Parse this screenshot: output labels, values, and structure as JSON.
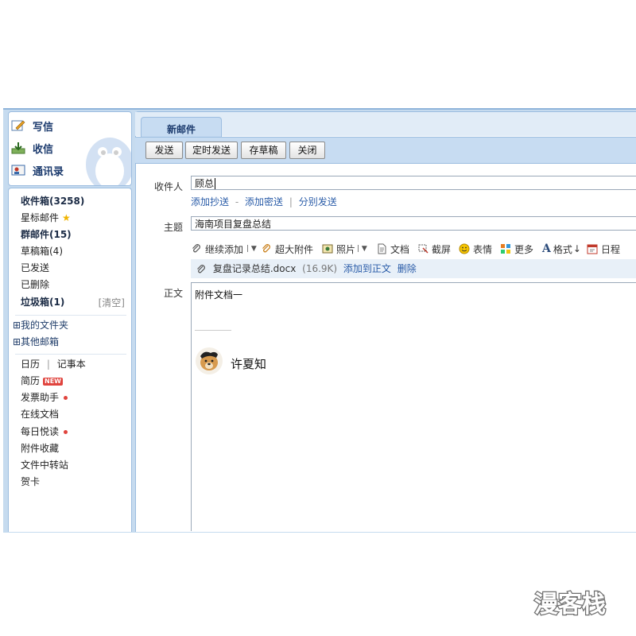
{
  "sidebar": {
    "actions": [
      {
        "label": "写信",
        "icon": "pencil-icon"
      },
      {
        "label": "收信",
        "icon": "inbox-download-icon"
      },
      {
        "label": "通讯录",
        "icon": "contacts-card-icon"
      }
    ],
    "folders": {
      "inbox": "收件箱(3258)",
      "starred": "星标邮件",
      "group": "群邮件(15)",
      "drafts": "草稿箱(4)",
      "sent": "已发送",
      "deleted": "已删除",
      "trash": "垃圾箱(1)",
      "trash_clear": "[清空]"
    },
    "tree": {
      "my_folders": "⊞我的文件夹",
      "other_mailboxes": "⊞其他邮箱"
    },
    "apps": {
      "calendar": "日历",
      "divider": "|",
      "notes": "记事本",
      "resume": "简历",
      "resume_badge": "NEW",
      "invoice": "发票助手",
      "online_docs": "在线文档",
      "daily_read": "每日悦读",
      "attachments": "附件收藏",
      "file_transfer": "文件中转站",
      "cards": "贺卡"
    }
  },
  "tab": {
    "label": "新邮件"
  },
  "toolbar": {
    "send": "发送",
    "schedule": "定时发送",
    "save_draft": "存草稿",
    "close": "关闭"
  },
  "compose": {
    "to_label": "收件人",
    "to_value": "顾总",
    "cc": "添加抄送",
    "dash": "-",
    "bcc": "添加密送",
    "pipe": "|",
    "separate": "分别发送",
    "subject_label": "主题",
    "subject_value": "海南项目复盘总结",
    "body_label": "正文",
    "body_text": "附件文档一",
    "signature_name": "许夏知"
  },
  "editor_tools": {
    "continue_add": "继续添加",
    "large_attach": "超大附件",
    "photo": "照片",
    "doc": "文档",
    "screenshot": "截屏",
    "emoji": "表情",
    "more": "更多",
    "format": "格式",
    "schedule": "日程"
  },
  "attachment": {
    "name": "复盘记录总结.docx",
    "size": "(16.9K)",
    "add_to_body": "添加到正文",
    "delete": "删除"
  },
  "watermark": {
    "text": "漫客栈"
  }
}
